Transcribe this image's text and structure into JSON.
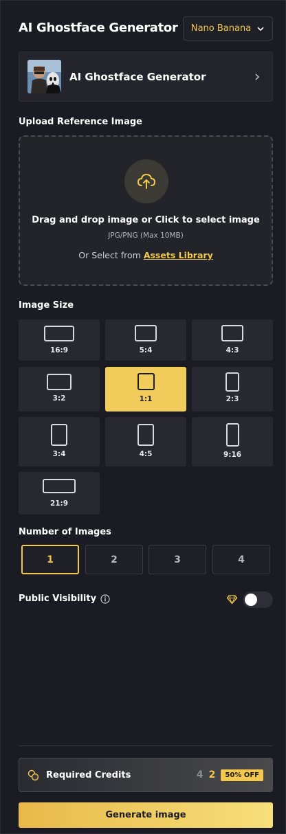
{
  "header": {
    "title": "AI Ghostface Generator",
    "model_label": "Nano Banana"
  },
  "preset": {
    "label": "AI Ghostface Generator"
  },
  "upload": {
    "section_label": "Upload Reference Image",
    "main_text": "Drag and drop image or Click to select image",
    "sub_text": "JPG/PNG (Max 10MB)",
    "alt_prefix": "Or Select from",
    "assets_link": "Assets Library"
  },
  "image_size": {
    "section_label": "Image Size",
    "selected": "1:1",
    "options": [
      "16:9",
      "5:4",
      "4:3",
      "3:2",
      "1:1",
      "2:3",
      "3:4",
      "4:5",
      "9:16",
      "21:9"
    ]
  },
  "num_images": {
    "section_label": "Number of Images",
    "options": [
      "1",
      "2",
      "3",
      "4"
    ],
    "selected": "1"
  },
  "visibility": {
    "label": "Public Visibility",
    "enabled": false
  },
  "credits": {
    "label": "Required Credits",
    "original": "4",
    "discounted": "2",
    "badge": "50% OFF"
  },
  "generate_label": "Generate image",
  "colors": {
    "accent": "#f2c94c",
    "background": "#1b1c23",
    "tile": "#272830"
  }
}
